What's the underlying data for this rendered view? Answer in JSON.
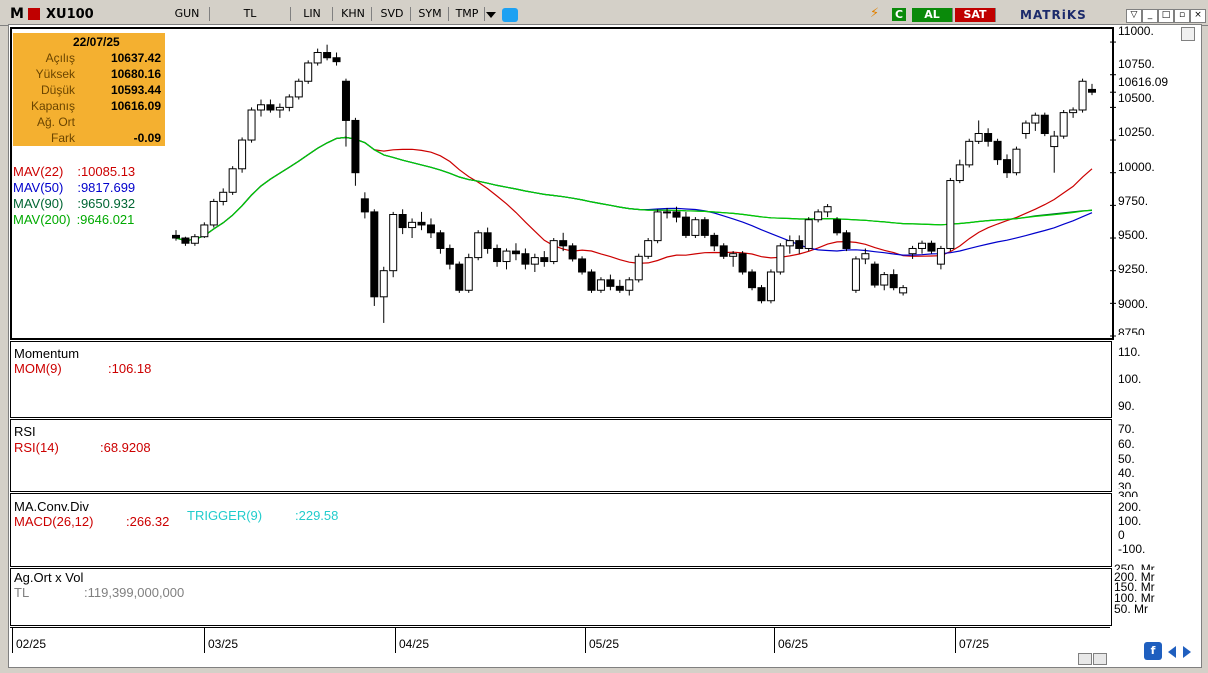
{
  "toolbar": {
    "logo": "M",
    "symbol": "XU100",
    "period": "GUN",
    "currency": "TL",
    "scale": "LIN",
    "buttons": [
      "KHN",
      "SVD",
      "SYM",
      "TMP"
    ],
    "buy_label": "AL",
    "sell_label": "SAT",
    "brand": "MATRiKS",
    "icons": [
      "lightning-icon",
      "refresh-icon",
      "twitter-icon"
    ]
  },
  "info": {
    "date": "22/07/25",
    "rows": [
      {
        "label": "Açılış",
        "value": "10637.42"
      },
      {
        "label": "Yüksek",
        "value": "10680.16"
      },
      {
        "label": "Düşük",
        "value": "10593.44"
      },
      {
        "label": "Kapanış",
        "value": "10616.09"
      },
      {
        "label": "Ağ. Ort",
        "value": ""
      },
      {
        "label": "Fark",
        "value": "-0.09"
      }
    ]
  },
  "legend": {
    "mav22": {
      "name": "MAV(22)",
      "value": ":10085.13",
      "color": "#cc0000"
    },
    "mav50": {
      "name": "MAV(50)",
      "value": ":9817.699",
      "color": "#0000cc"
    },
    "mav90": {
      "name": "MAV(90)",
      "value": ":9650.932",
      "color": "#006633"
    },
    "mav200": {
      "name": "MAV(200)",
      "value": ":9646.021",
      "color": "#00cc00"
    }
  },
  "panels": {
    "momentum": {
      "title": "Momentum",
      "name": "MOM(9)",
      "value": ":106.18"
    },
    "rsi": {
      "title": "RSI",
      "name": "RSI(14)",
      "value": ":68.9208"
    },
    "macd": {
      "title": "MA.Conv.Div",
      "name": "MACD(26,12)",
      "value": ":266.32",
      "trigger_name": "TRIGGER(9)",
      "trigger_value": ":229.58"
    },
    "volume": {
      "title": "Ag.Ort x Vol",
      "name": "TL",
      "value": ":119,399,000,000"
    }
  },
  "price_axis": {
    "ticks": [
      "11000.",
      "10750.",
      "10616.09",
      "10500.",
      "10250.",
      "10000.",
      "9750.",
      "9500.",
      "9250.",
      "9000.",
      "8750."
    ]
  },
  "mom_axis": {
    "ticks": [
      "110.",
      "100.",
      "90."
    ]
  },
  "rsi_axis": {
    "ticks": [
      "70.",
      "60.",
      "50.",
      "40.",
      "30."
    ]
  },
  "macd_axis": {
    "ticks": [
      "300.",
      "200.",
      "100.",
      "0",
      "-100."
    ]
  },
  "vol_axis": {
    "ticks": [
      "250. Mr",
      "200. Mr",
      "150. Mr",
      "100. Mr",
      "50. Mr"
    ]
  },
  "time_axis": {
    "labels": [
      "02/25",
      "03/25",
      "04/25",
      "05/25",
      "06/25",
      "07/25"
    ]
  },
  "chart_data": {
    "type": "candlestick",
    "title": "XU100",
    "ylim": [
      8750,
      11100
    ],
    "candles": [
      [
        9520,
        9560,
        9480,
        9500
      ],
      [
        9500,
        9510,
        9440,
        9460
      ],
      [
        9460,
        9530,
        9440,
        9510
      ],
      [
        9510,
        9620,
        9500,
        9600
      ],
      [
        9600,
        9800,
        9580,
        9780
      ],
      [
        9780,
        9880,
        9750,
        9850
      ],
      [
        9850,
        10050,
        9830,
        10030
      ],
      [
        10030,
        10270,
        10000,
        10250
      ],
      [
        10250,
        10500,
        10230,
        10480
      ],
      [
        10480,
        10560,
        10430,
        10520
      ],
      [
        10520,
        10560,
        10460,
        10480
      ],
      [
        10480,
        10530,
        10420,
        10500
      ],
      [
        10500,
        10600,
        10470,
        10580
      ],
      [
        10580,
        10720,
        10560,
        10700
      ],
      [
        10700,
        10860,
        10680,
        10840
      ],
      [
        10840,
        10950,
        10820,
        10920
      ],
      [
        10920,
        10980,
        10860,
        10880
      ],
      [
        10880,
        10920,
        10820,
        10850
      ],
      [
        10700,
        10720,
        10200,
        10400
      ],
      [
        10400,
        10420,
        9900,
        10000
      ],
      [
        9800,
        9850,
        9650,
        9700
      ],
      [
        9700,
        9720,
        8980,
        9050
      ],
      [
        9050,
        9280,
        8850,
        9250
      ],
      [
        9250,
        9700,
        9200,
        9680
      ],
      [
        9680,
        9720,
        9530,
        9580
      ],
      [
        9580,
        9650,
        9500,
        9620
      ],
      [
        9620,
        9700,
        9560,
        9600
      ],
      [
        9600,
        9650,
        9500,
        9540
      ],
      [
        9540,
        9560,
        9380,
        9420
      ],
      [
        9420,
        9450,
        9260,
        9300
      ],
      [
        9300,
        9320,
        9080,
        9100
      ],
      [
        9100,
        9380,
        9080,
        9350
      ],
      [
        9350,
        9560,
        9330,
        9540
      ],
      [
        9540,
        9580,
        9380,
        9420
      ],
      [
        9420,
        9450,
        9280,
        9320
      ],
      [
        9320,
        9420,
        9260,
        9400
      ],
      [
        9400,
        9460,
        9330,
        9380
      ],
      [
        9380,
        9420,
        9260,
        9300
      ],
      [
        9300,
        9380,
        9240,
        9350
      ],
      [
        9350,
        9400,
        9280,
        9320
      ],
      [
        9320,
        9500,
        9300,
        9480
      ],
      [
        9480,
        9540,
        9400,
        9440
      ],
      [
        9440,
        9460,
        9320,
        9340
      ],
      [
        9340,
        9360,
        9220,
        9240
      ],
      [
        9240,
        9260,
        9080,
        9100
      ],
      [
        9100,
        9200,
        9080,
        9180
      ],
      [
        9180,
        9220,
        9100,
        9130
      ],
      [
        9130,
        9180,
        9080,
        9100
      ],
      [
        9100,
        9200,
        9060,
        9180
      ],
      [
        9180,
        9380,
        9160,
        9360
      ],
      [
        9360,
        9500,
        9340,
        9480
      ],
      [
        9480,
        9720,
        9460,
        9700
      ],
      [
        9700,
        9730,
        9650,
        9700
      ],
      [
        9700,
        9740,
        9620,
        9660
      ],
      [
        9660,
        9700,
        9500,
        9520
      ],
      [
        9520,
        9660,
        9500,
        9640
      ],
      [
        9640,
        9660,
        9500,
        9520
      ],
      [
        9520,
        9540,
        9400,
        9440
      ],
      [
        9440,
        9460,
        9340,
        9360
      ],
      [
        9360,
        9400,
        9280,
        9380
      ],
      [
        9380,
        9400,
        9220,
        9240
      ],
      [
        9240,
        9260,
        9100,
        9120
      ],
      [
        9120,
        9140,
        9000,
        9020
      ],
      [
        9020,
        9260,
        9000,
        9240
      ],
      [
        9240,
        9460,
        9220,
        9440
      ],
      [
        9440,
        9520,
        9380,
        9480
      ],
      [
        9480,
        9520,
        9380,
        9420
      ],
      [
        9420,
        9660,
        9400,
        9640
      ],
      [
        9640,
        9720,
        9620,
        9700
      ],
      [
        9700,
        9760,
        9660,
        9740
      ],
      [
        9640,
        9660,
        9520,
        9540
      ],
      [
        9540,
        9560,
        9400,
        9420
      ],
      [
        9100,
        9360,
        9080,
        9340
      ],
      [
        9340,
        9420,
        9300,
        9380
      ],
      [
        9300,
        9320,
        9120,
        9140
      ],
      [
        9140,
        9240,
        9100,
        9220
      ],
      [
        9220,
        9260,
        9100,
        9120
      ],
      [
        9080,
        9140,
        9060,
        9120
      ],
      [
        9380,
        9440,
        9340,
        9420
      ],
      [
        9420,
        9480,
        9380,
        9460
      ],
      [
        9460,
        9480,
        9380,
        9400
      ],
      [
        9300,
        9440,
        9260,
        9420
      ],
      [
        9420,
        9960,
        9400,
        9940
      ],
      [
        9940,
        10100,
        9920,
        10060
      ],
      [
        10060,
        10260,
        10040,
        10240
      ],
      [
        10240,
        10400,
        10220,
        10300
      ],
      [
        10300,
        10340,
        10200,
        10240
      ],
      [
        10240,
        10260,
        10060,
        10100
      ],
      [
        10100,
        10140,
        9960,
        10000
      ],
      [
        10000,
        10200,
        9980,
        10180
      ],
      [
        10300,
        10400,
        10260,
        10380
      ],
      [
        10380,
        10460,
        10320,
        10440
      ],
      [
        10440,
        10460,
        10280,
        10300
      ],
      [
        10200,
        10320,
        10000,
        10280
      ],
      [
        10280,
        10480,
        10260,
        10460
      ],
      [
        10460,
        10500,
        10420,
        10480
      ],
      [
        10480,
        10720,
        10460,
        10700
      ],
      [
        10637.42,
        10680.16,
        10593.44,
        10616.09
      ]
    ],
    "series": [
      {
        "name": "MAV(22)",
        "last": 10085.13
      },
      {
        "name": "MAV(50)",
        "last": 9817.699
      },
      {
        "name": "MAV(90)",
        "last": 9650.932
      },
      {
        "name": "MAV(200)",
        "last": 9646.021
      },
      {
        "name": "MOM(9)",
        "last": 106.18
      },
      {
        "name": "RSI(14)",
        "last": 68.9208
      },
      {
        "name": "MACD(26,12)",
        "last": 266.32
      },
      {
        "name": "TRIGGER(9)",
        "last": 229.58
      }
    ]
  }
}
